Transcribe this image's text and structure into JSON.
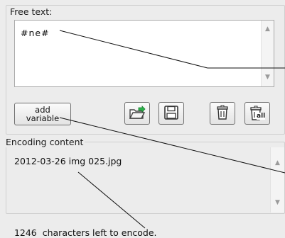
{
  "free_text": {
    "label": "Free text:",
    "value": "#ne#"
  },
  "buttons": {
    "add_variable_line1": "add",
    "add_variable_line2": "variable",
    "icons": [
      "folder-open-icon",
      "save-icon",
      "trash-icon",
      "trash-all-icon"
    ],
    "trash_all_sub": "all"
  },
  "encoding": {
    "label": "Encoding content",
    "value": "2012-03-26 img 025.jpg"
  },
  "status": {
    "count": "1246",
    "text": "characters left to encode."
  }
}
